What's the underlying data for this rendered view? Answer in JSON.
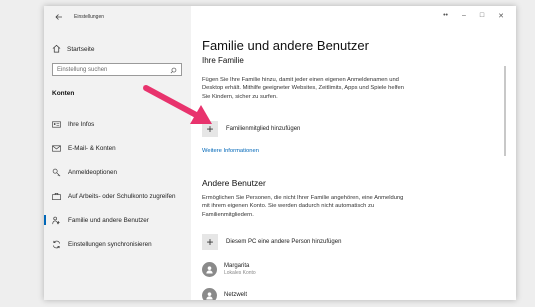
{
  "window": {
    "title": "Einstellungen",
    "controls": {
      "pin": "••",
      "minimize": "–",
      "maximize": "□",
      "close": "✕"
    }
  },
  "sidebar": {
    "home_label": "Startseite",
    "search_placeholder": "Einstellung suchen",
    "section_heading": "Konten",
    "items": [
      {
        "label": "Ihre Infos",
        "icon": "person-card-icon"
      },
      {
        "label": "E-Mail- & Konten",
        "icon": "mail-icon"
      },
      {
        "label": "Anmeldeoptionen",
        "icon": "key-icon"
      },
      {
        "label": "Auf Arbeits- oder Schulkonto zugreifen",
        "icon": "briefcase-icon"
      },
      {
        "label": "Familie und andere Benutzer",
        "icon": "family-icon"
      },
      {
        "label": "Einstellungen synchronisieren",
        "icon": "sync-icon"
      }
    ],
    "active_index": 4
  },
  "main": {
    "title": "Familie und andere Benutzer",
    "family": {
      "heading": "Ihre Familie",
      "description": "Fügen Sie Ihre Familie hinzu, damit jeder einen eigenen Anmeldenamen und Desktop erhält. Mithilfe geeigneter Websites, Zeitlimits, Apps und Spiele helfen Sie Kindern, sicher zu surfen.",
      "add_label": "Familienmitglied hinzufügen",
      "more_info_link": "Weitere Informationen"
    },
    "others": {
      "heading": "Andere Benutzer",
      "description": "Ermöglichen Sie Personen, die nicht Ihrer Familie angehören, eine Anmeldung mit ihrem eigenen Konto. Sie werden dadurch nicht automatisch zu Familienmitgliedern.",
      "add_label": "Diesem PC eine andere Person hinzufügen",
      "users": [
        {
          "name": "Margarita",
          "subtitle": "Lokales Konto"
        },
        {
          "name": "Netzwelt",
          "subtitle": ""
        }
      ]
    }
  },
  "colors": {
    "accent": "#0067b8",
    "arrow": "#e8336d",
    "sidebar_bg": "#f2f2f2"
  }
}
